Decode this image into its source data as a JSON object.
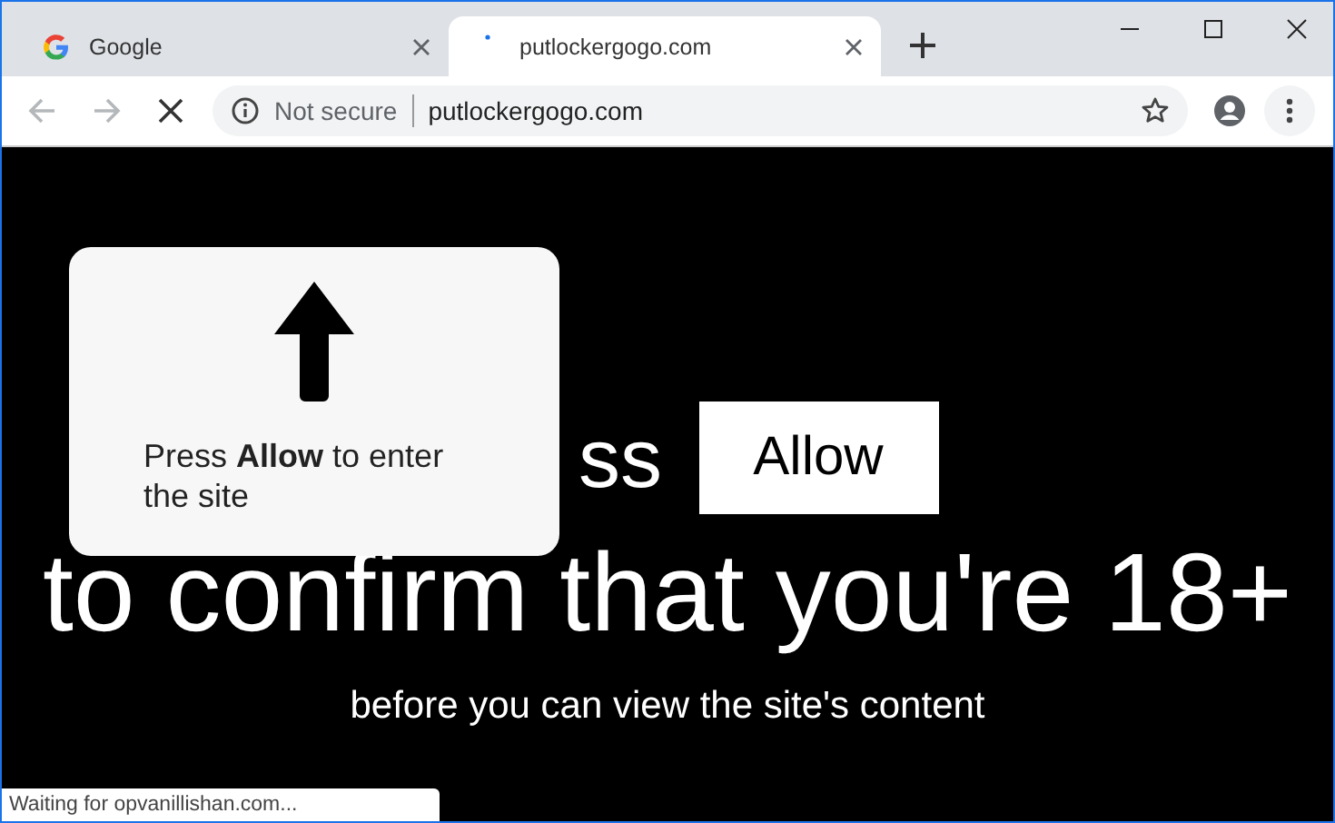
{
  "tabs": [
    {
      "title": "Google",
      "selected": false,
      "loading": false
    },
    {
      "title": "putlockergogo.com",
      "selected": true,
      "loading": true
    }
  ],
  "toolbar": {
    "security": "Not secure",
    "url": "putlockergogo.com",
    "loading": true
  },
  "page": {
    "heading_visible": "ss",
    "allow_button": "Allow",
    "confirm_line": "to confirm that you're 18+",
    "subline": "before you can view the site's content"
  },
  "prompt_card": {
    "text": "Press **Allow** to enter the site"
  },
  "status_bar": "Waiting for opvanillishan.com..."
}
